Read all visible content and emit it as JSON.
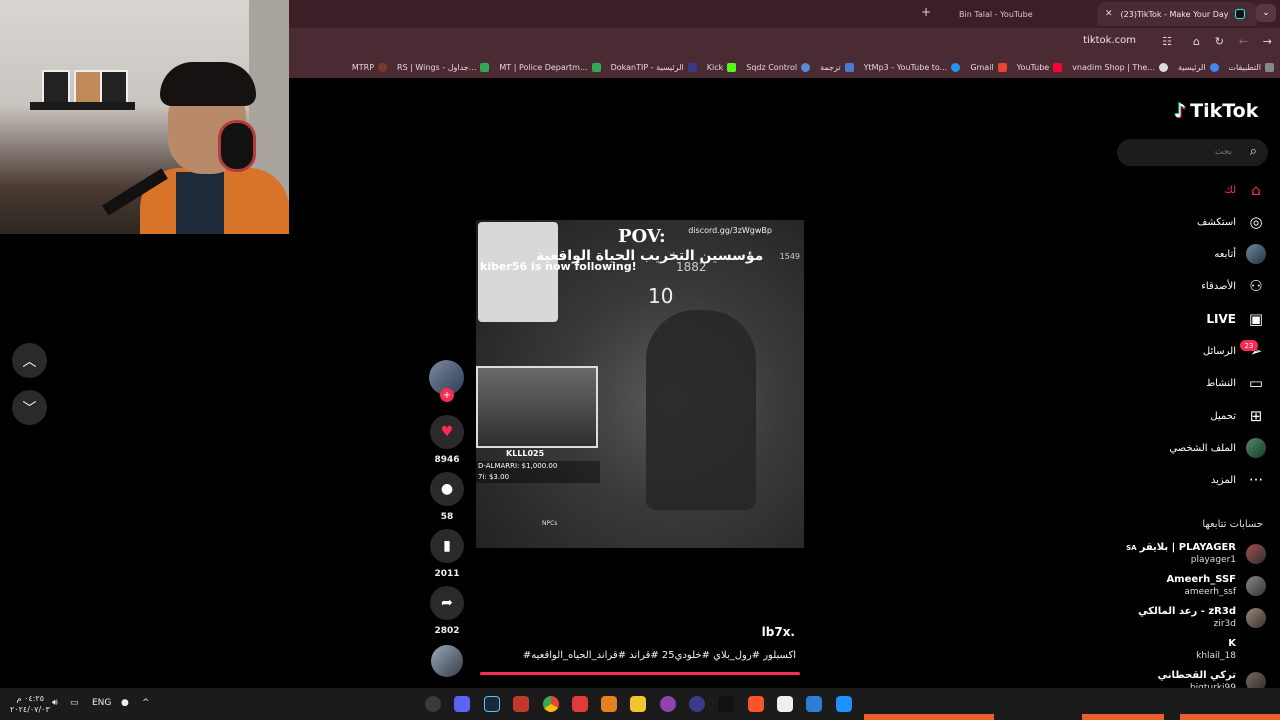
{
  "browser": {
    "tabs": [
      {
        "title": "(23)TikTok - Make Your Day",
        "active": true
      },
      {
        "title": "Bin Talal - YouTube",
        "active": false
      }
    ],
    "url": "tiktok.com",
    "bookmarks": [
      "التطبيقات",
      "الرئيسية",
      "vnadim Shop | The...",
      "YouTube",
      "Gmail",
      "YtMp3 - YouTube to...",
      "ترجمة",
      "Sqdz Control",
      "Kick",
      "DokanTIP - الرئيسية",
      "MT | Police Departm...",
      "RS | Wings - جداول...",
      "MTRP"
    ]
  },
  "video": {
    "pov": "POV:",
    "discord": "discord.gg/3zWgwBp",
    "arabic_title": "مؤسسين التخريب الحياة الواقعية",
    "follow_notice": "kiber56 is now following!",
    "counter": "10",
    "num_a": "1882",
    "num_b": "1549",
    "cam_label": "KLLL025",
    "money_line1": "D-ALMARRI: $1,000.00",
    "money_line2": "7i: $3.00",
    "npcs": "NPCs"
  },
  "actions": {
    "likes": "8946",
    "comments": "58",
    "saves": "2011",
    "shares": "2802"
  },
  "caption": {
    "username": "lb7x.",
    "tags": "#اكسبلور #رول_بلاي #خلودي25 #قراند #قراند_الحياه_الواقعيه"
  },
  "sidebar": {
    "logo": "TikTok",
    "search_placeholder": "بحث",
    "items": [
      {
        "label": "لك",
        "icon": "home-icon"
      },
      {
        "label": "استكشف",
        "icon": "compass-icon"
      },
      {
        "label": "أتابعه",
        "icon": "avatar"
      },
      {
        "label": "الأصدقاء",
        "icon": "friends-icon"
      },
      {
        "label": "LIVE",
        "icon": "live-icon"
      },
      {
        "label": "الرسائل",
        "icon": "inbox-icon"
      },
      {
        "label": "النشاط",
        "icon": "activity-icon"
      },
      {
        "label": "تحميل",
        "icon": "upload-icon"
      },
      {
        "label": "الملف الشخصي",
        "icon": "profile-avatar"
      },
      {
        "label": "المزيد",
        "icon": "more-icon"
      }
    ],
    "messages_badge": "23",
    "following_title": "حسابات تتابعها",
    "following": [
      {
        "name": "بلايقر | PLAYAGER",
        "prefix": "SA",
        "handle": "playager1"
      },
      {
        "name": "Ameerh_SSF",
        "prefix": "",
        "handle": "ameerh_ssf"
      },
      {
        "name": "رعد المالكي - zR3d",
        "prefix": "",
        "handle": "zir3d"
      },
      {
        "name": "K",
        "prefix": "",
        "handle": "khlail_18"
      },
      {
        "name": "تركي القحطاني",
        "prefix": "",
        "handle": "bigturki99"
      }
    ]
  },
  "taskbar": {
    "time": "٠٤:٢٥ م",
    "date": "٢٠٢٤/٠٧/٠٣",
    "lang": "ENG"
  },
  "colors": {
    "accent": "#fe2c55",
    "chrome": "#4a2b34",
    "tabbar": "#3a1f27"
  }
}
